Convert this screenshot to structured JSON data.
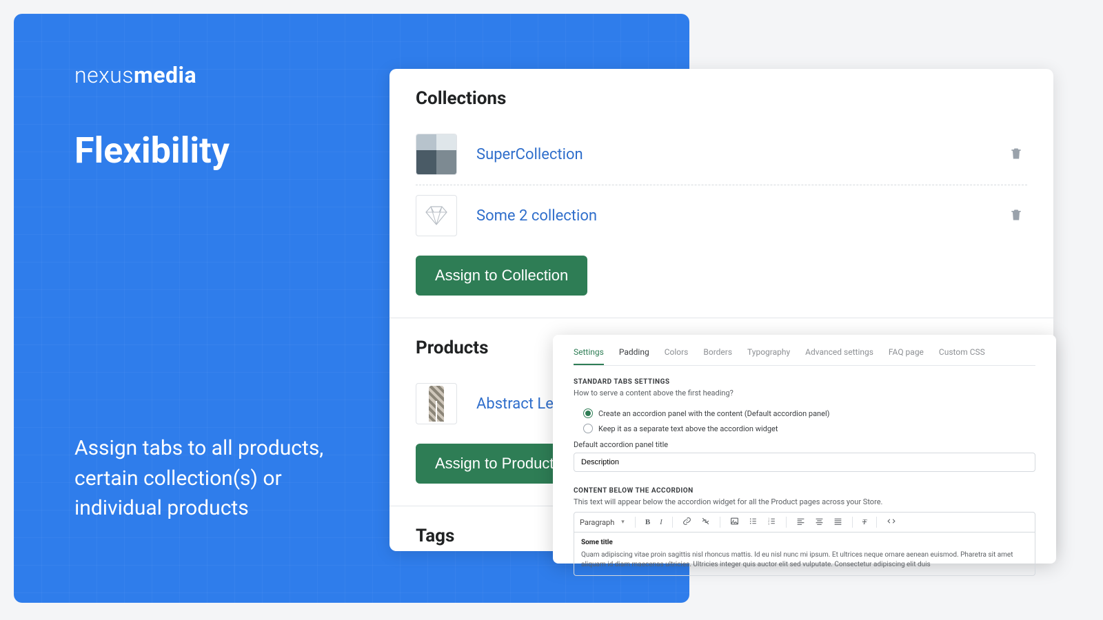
{
  "hero": {
    "brand_light": "nexus",
    "brand_bold": "media",
    "title": "Flexibility",
    "subtitle": "Assign tabs to all products, certain collection(s) or individual products"
  },
  "collections": {
    "heading": "Collections",
    "items": [
      {
        "name": "SuperCollection"
      },
      {
        "name": "Some 2 collection"
      }
    ],
    "assign_button": "Assign to Collection"
  },
  "products": {
    "heading": "Products",
    "items": [
      {
        "name": "Abstract Leg"
      }
    ],
    "assign_button": "Assign to Product"
  },
  "tags": {
    "heading": "Tags"
  },
  "settings": {
    "tabs": [
      "Settings",
      "Padding",
      "Colors",
      "Borders",
      "Typography",
      "Advanced settings",
      "FAQ page",
      "Custom CSS"
    ],
    "section1_label": "STANDARD TABS SETTINGS",
    "section1_help": "How to serve a content above the first heading?",
    "radio_options": [
      "Create an accordion panel with the content (Default accordion panel)",
      "Keep it as a separate text above the accordion widget"
    ],
    "default_title_label": "Default accordion panel title",
    "default_title_value": "Description",
    "section2_label": "CONTENT BELOW THE ACCORDION",
    "section2_help": "This text will appear below the accordion widget for all the Product pages across your Store.",
    "toolbar": {
      "paragraph": "Paragraph"
    },
    "editor_title": "Some title",
    "editor_body": "Quam adipiscing vitae proin sagittis nisl rhoncus mattis. Id eu nisl nunc mi ipsum. Et ultrices neque ornare aenean euismod. Pharetra sit amet aliquam id diam maecenas ultricies. Ultricies integer quis auctor elit sed vulputate. Consectetur adipiscing elit duis"
  }
}
